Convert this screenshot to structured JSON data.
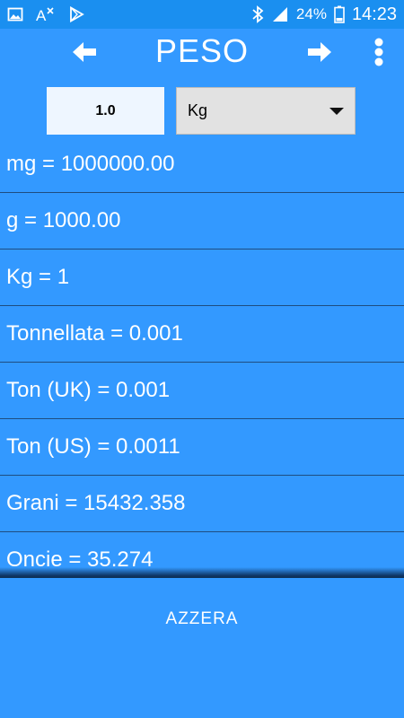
{
  "status_bar": {
    "battery_text": "24%",
    "time": "14:23",
    "icons": [
      "gallery-icon",
      "translate-icon",
      "play-store-icon",
      "bluetooth-icon",
      "signal-icon",
      "battery-icon"
    ]
  },
  "app_bar": {
    "title": "PESO",
    "back_icon": "arrow-left-icon",
    "forward_icon": "arrow-right-icon",
    "menu_icon": "more-vert-icon"
  },
  "input": {
    "value": "1.0",
    "unit_selected": "Kg"
  },
  "results": [
    "mg = 1000000.00",
    "g = 1000.00",
    "Kg = 1",
    "Tonnellata = 0.001",
    "Ton (UK) = 0.001",
    "Ton (US) = 0.0011",
    "Grani = 15432.358",
    "Oncie = 35.274"
  ],
  "reset_label": "AZZERA",
  "colors": {
    "background": "#3399ff",
    "status_bar": "#1a8ff0",
    "divider": "#1f4d80",
    "select_bg": "#e2e2e2"
  }
}
